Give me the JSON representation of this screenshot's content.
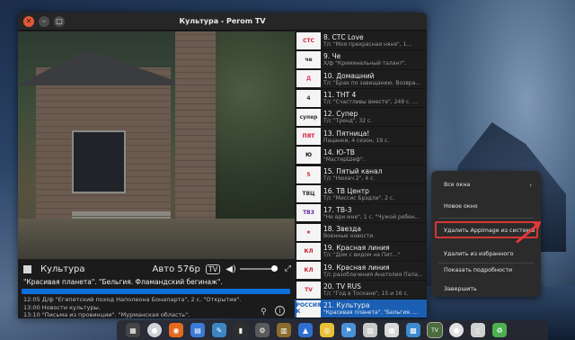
{
  "window": {
    "title": "Культура - Perom TV"
  },
  "player": {
    "channel": "Культура",
    "quality": "Авто 576p",
    "tv_label": "TV",
    "now_title": "\"Красивая планета\". \"Бельгия. Фламандский бегинаж\".",
    "progress": 0.99,
    "schedule": [
      "12:05 Д/ф \"Египетский поход Наполеона Бонапарта\", 2 с. \"Открытие\".",
      "13:00 Новости культуры.",
      "13:10 \"Письма из провинции\". \"Мурманская область\"."
    ],
    "icons": [
      "stop-icon",
      "tv-icon",
      "volume-icon",
      "fullscreen-icon",
      "pin-icon",
      "info-icon"
    ]
  },
  "channels": [
    {
      "name": "8. СТС Love",
      "program": "Т/с \"Моя прекрасная няня\", 1...",
      "logo": "СТС",
      "color": "#d8263c"
    },
    {
      "name": "9. Че",
      "program": "Х/ф \"Криминальный талант\".",
      "logo": "че",
      "color": "#222222"
    },
    {
      "name": "10. Домашний",
      "program": "Т/с \"Брак по завещанию. Возвра...",
      "logo": "Д",
      "color": "#e4427a"
    },
    {
      "name": "11. ТНТ 4",
      "program": "Т/с \"Счастливы вместе\", 249 с. ...",
      "logo": "4",
      "color": "#333333"
    },
    {
      "name": "12. Супер",
      "program": "Т/с \"Тренд\", 32 с.",
      "logo": "супер",
      "color": "#333333"
    },
    {
      "name": "13. Пятница!",
      "program": "Пацанки, 4 сезон, 19 с.",
      "logo": "ПЯТ",
      "color": "#e0143c"
    },
    {
      "name": "14. Ю-ТВ",
      "program": "\"МастерШеф\".",
      "logo": "Ю",
      "color": "#111111"
    },
    {
      "name": "15. Пятый канал",
      "program": "Т/с \"Нюхач 2\", 4 с.",
      "logo": "5",
      "color": "#d8263c"
    },
    {
      "name": "16. ТВ Центр",
      "program": "Т/с \"Миссис Брэдли\", 2 с.",
      "logo": "ТВЦ",
      "color": "#333333"
    },
    {
      "name": "17. ТВ-3",
      "program": "\"Не ври мне\", 1 с. \"Чужой ребен...",
      "logo": "ТВ3",
      "color": "#6a2ca0"
    },
    {
      "name": "18. Звезда",
      "program": "Военные новости.",
      "logo": "★",
      "color": "#c81e2b"
    },
    {
      "name": "19. Красная линия",
      "program": "Т/с \"Дом с видом на Пит...\"",
      "logo": "КЛ",
      "color": "#c81e2b"
    },
    {
      "name": "19. Красная линия",
      "program": "Т/с разоблачения Анатолия Папа...",
      "logo": "КЛ",
      "color": "#c81e2b"
    },
    {
      "name": "20. TV RUS",
      "program": "Т/с \"Год в Тоскане\", 15 и 16 с.",
      "logo": "TV",
      "color": "#d8263c"
    },
    {
      "name": "21. Культура",
      "program": "\"Красивая планета\". \"Бельгия. ...",
      "logo": "РОССИЯ К",
      "color": "#1a5fb4",
      "active": true
    }
  ],
  "context_menu": {
    "all_windows": "Все окна",
    "new_window": "Новое окно",
    "remove_appimage": "Удалить AppImage из системы",
    "remove_favorites": "Удалить из избранного",
    "show_details": "Показать подробности",
    "quit": "Завершить"
  },
  "dock": {
    "icons": [
      "apps-grid-icon",
      "circle-icon",
      "firefox-icon",
      "files-icon",
      "text-editor-icon",
      "terminal-icon",
      "settings-icon",
      "archive-icon",
      "store-icon",
      "chrome-icon",
      "flag-icon",
      "image-icon",
      "calendar-icon",
      "folder-icon",
      "tv-icon",
      "ball-icon",
      "ipod-icon",
      "recycle-icon"
    ]
  }
}
